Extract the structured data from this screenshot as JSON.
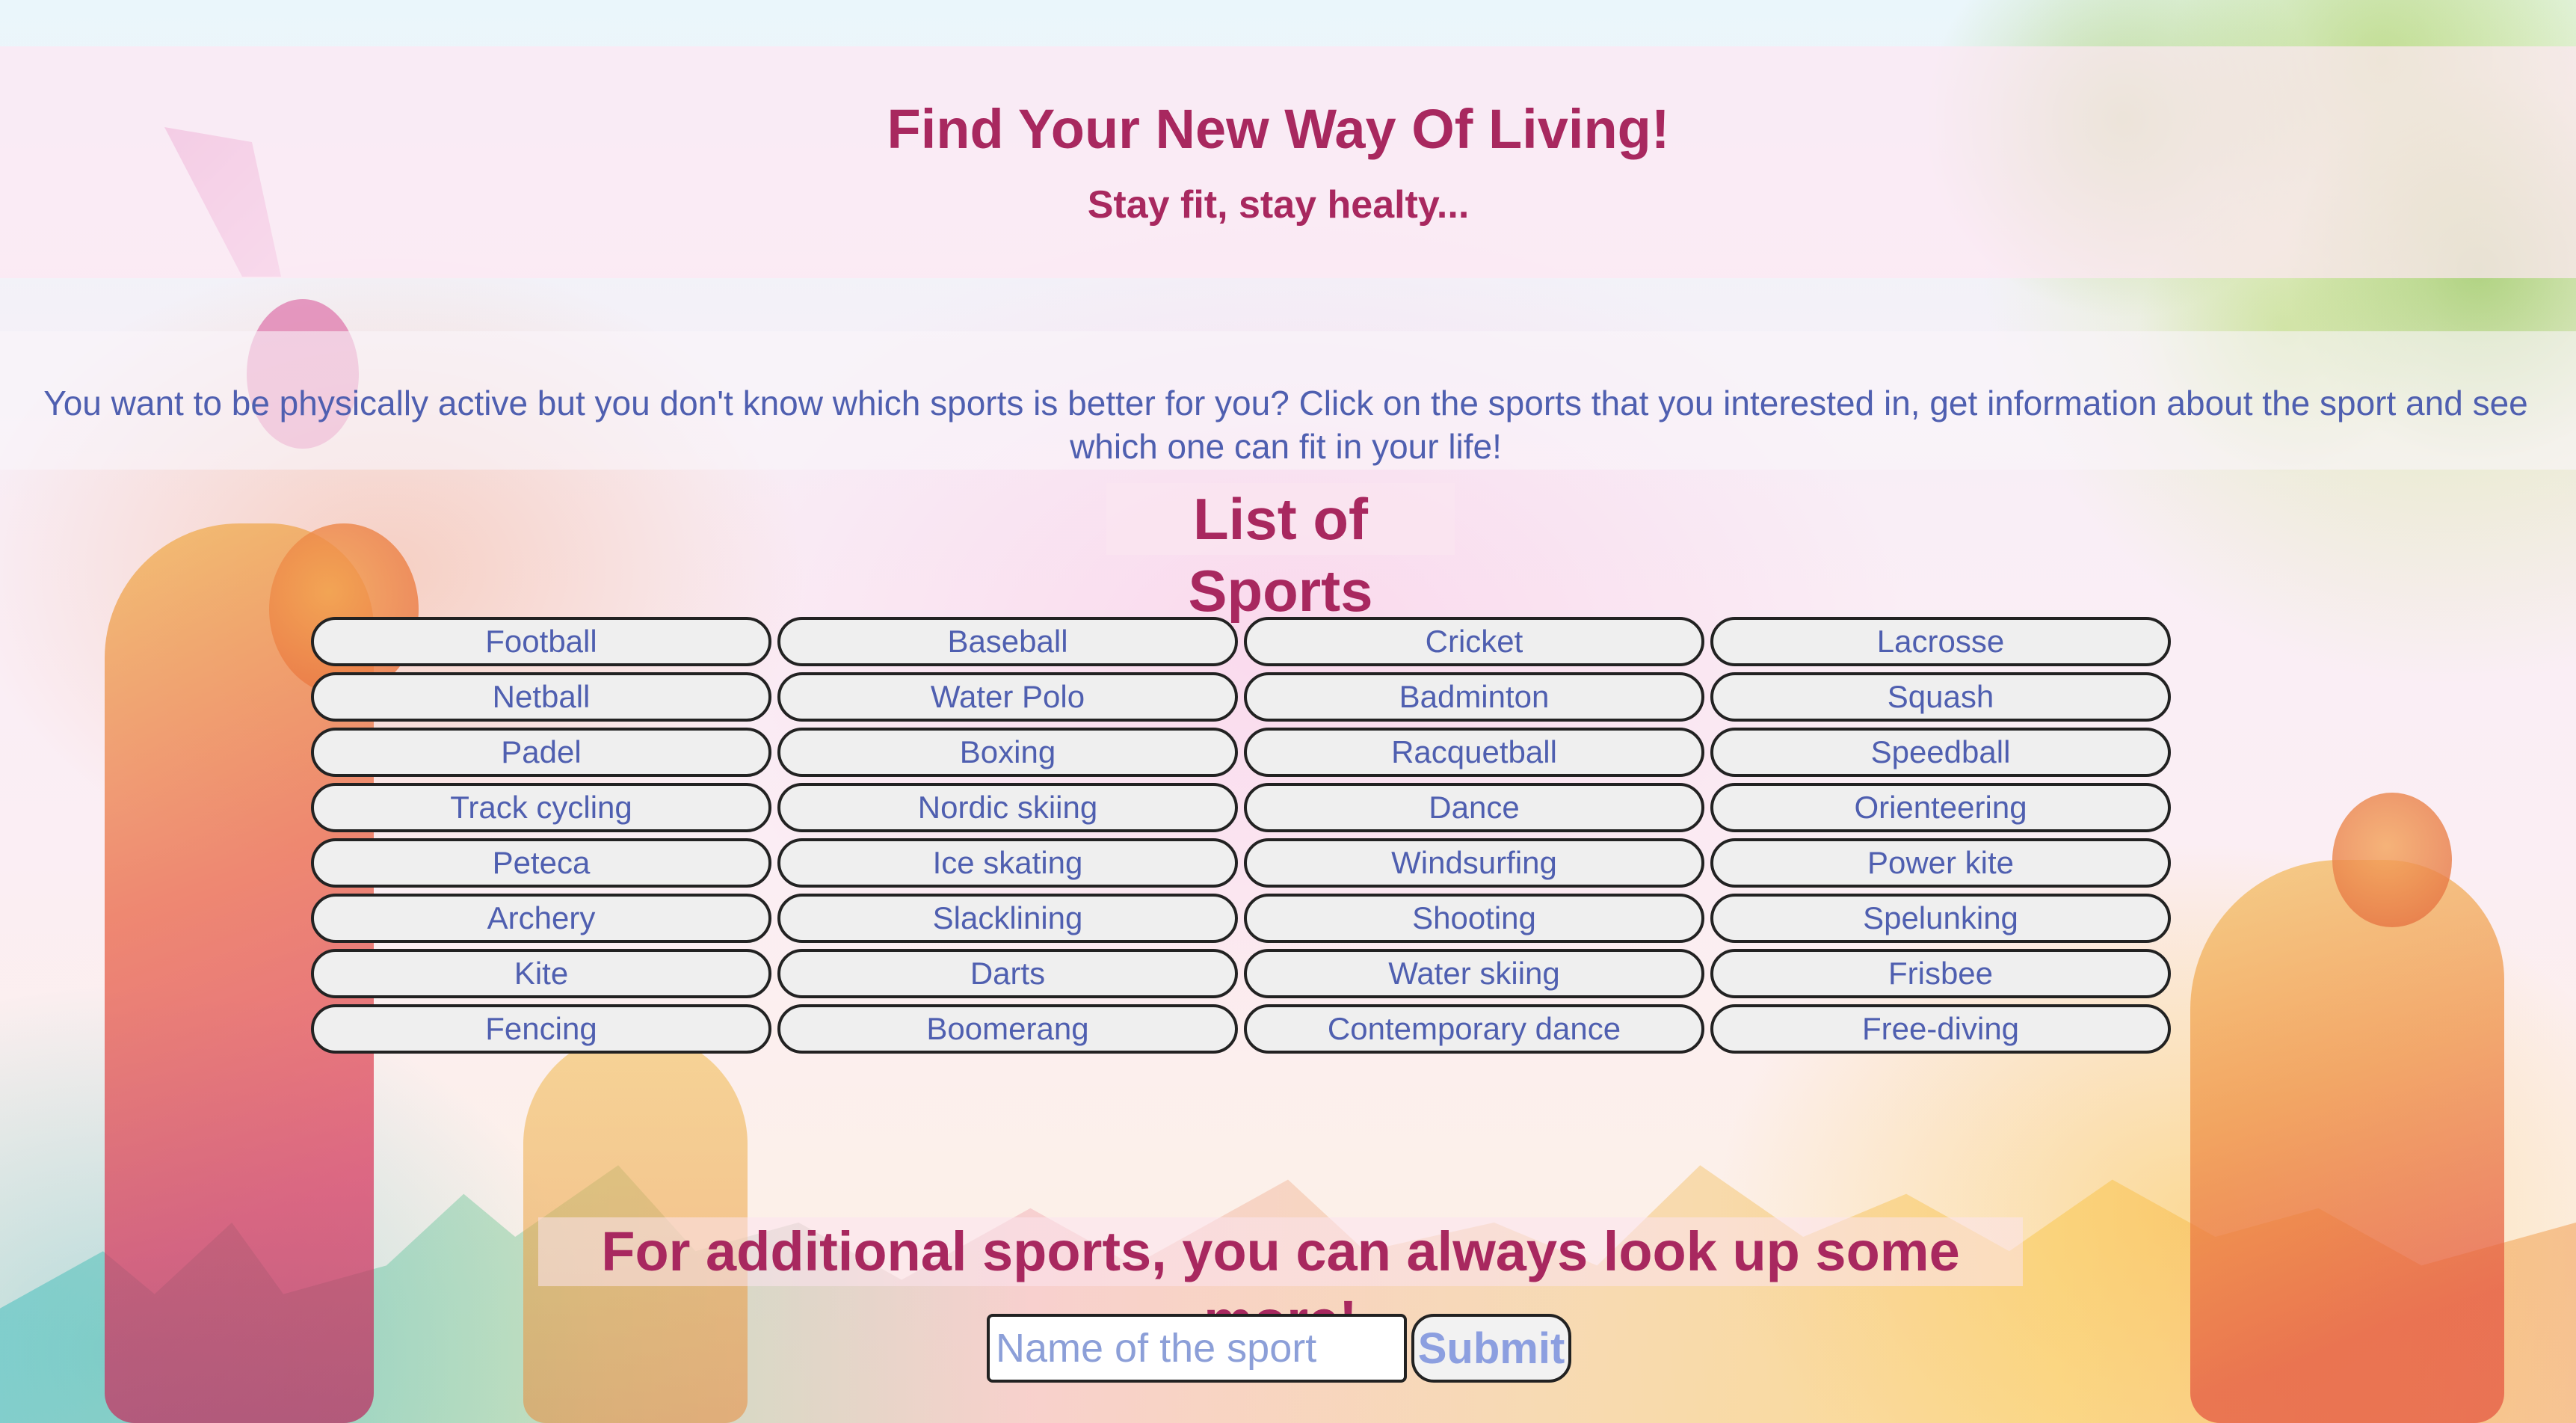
{
  "header": {
    "title": "Find Your New Way Of Living!",
    "subtitle": "Stay fit, stay healty..."
  },
  "intro": {
    "text": "You want to be physically active but you don't know which sports is better for you? Click on the sports that you interested in, get information about the sport and see which one can fit in your life!"
  },
  "list": {
    "title": "List of Sports",
    "sports": [
      "Football",
      "Baseball",
      "Cricket",
      "Lacrosse",
      "Netball",
      "Water Polo",
      "Badminton",
      "Squash",
      "Padel",
      "Boxing",
      "Racquetball",
      "Speedball",
      "Track cycling",
      "Nordic skiing",
      "Dance",
      "Orienteering",
      "Peteca",
      "Ice skating",
      "Windsurfing",
      "Power kite",
      "Archery",
      "Slacklining",
      "Shooting",
      "Spelunking",
      "Kite",
      "Darts",
      "Water skiing",
      "Frisbee",
      "Fencing",
      "Boomerang",
      "Contemporary dance",
      "Free-diving"
    ]
  },
  "more": {
    "title": "For additional sports, you can always look up some more!",
    "input_placeholder": "Name of the sport",
    "submit_label": "Submit"
  },
  "colors": {
    "heading": "#a8285f",
    "body_text": "#4f5fb0",
    "button_bg": "#efefef",
    "submit_text": "#8c9fe0"
  }
}
